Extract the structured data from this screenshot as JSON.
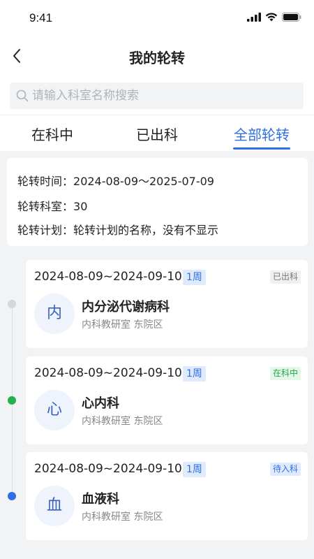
{
  "status_bar": {
    "time": "9:41"
  },
  "nav": {
    "title": "我的轮转"
  },
  "search": {
    "placeholder": "请输入科室名称搜索"
  },
  "tabs": [
    {
      "label": "在科中",
      "active": false
    },
    {
      "label": "已出科",
      "active": false
    },
    {
      "label": "全部轮转",
      "active": true
    }
  ],
  "info": {
    "time_label": "轮转时间：",
    "time_value": "2024-08-09～2025-07-09",
    "dept_label": "轮转科室：",
    "dept_value": "30",
    "plan_label": "轮转计划：",
    "plan_value": "轮转计划的名称，没有不显示"
  },
  "colors": {
    "accent": "#2f6fe4",
    "done_dot": "#d5d7da",
    "active_dot": "#22b14c",
    "pending_dot": "#2f6fe4"
  },
  "rotations": [
    {
      "date": "2024-08-09~2024-09-10",
      "duration": "1周",
      "status": "已出科",
      "avatar_char": "内",
      "name": "内分泌代谢病科",
      "sub": "内科教研室 东院区"
    },
    {
      "date": "2024-08-09~2024-09-10",
      "duration": "1周",
      "status": "在科中",
      "avatar_char": "心",
      "name": "心内科",
      "sub": "内科教研室 东院区"
    },
    {
      "date": "2024-08-09~2024-09-10",
      "duration": "1周",
      "status": "待入科",
      "avatar_char": "血",
      "name": "血液科",
      "sub": "内科教研室 东院区"
    }
  ]
}
